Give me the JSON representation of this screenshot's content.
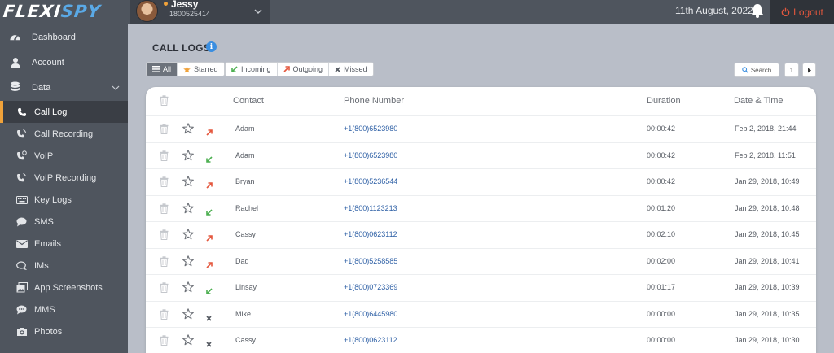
{
  "header": {
    "logo_part1": "FLEXI",
    "logo_part2": "SPY",
    "user": {
      "name": "Jessy",
      "phone": "1800525414"
    },
    "date": "11th August, 2022",
    "logout_label": "Logout"
  },
  "sidebar": {
    "items": [
      {
        "label": "Dashboard",
        "icon": "dashboard-icon"
      },
      {
        "label": "Account",
        "icon": "user-icon"
      },
      {
        "label": "Data",
        "icon": "database-icon"
      },
      {
        "label": "Call Log",
        "icon": "phone-icon",
        "active": true
      },
      {
        "label": "Call Recording",
        "icon": "call-recording-icon"
      },
      {
        "label": "VoIP",
        "icon": "voip-icon"
      },
      {
        "label": "VoIP Recording",
        "icon": "voip-recording-icon"
      },
      {
        "label": "Key Logs",
        "icon": "keyboard-icon"
      },
      {
        "label": "SMS",
        "icon": "chat-bubble-icon"
      },
      {
        "label": "Emails",
        "icon": "envelope-icon"
      },
      {
        "label": "IMs",
        "icon": "im-icon"
      },
      {
        "label": "App Screenshots",
        "icon": "screenshot-icon"
      },
      {
        "label": "MMS",
        "icon": "mms-icon"
      },
      {
        "label": "Photos",
        "icon": "camera-icon"
      }
    ]
  },
  "main": {
    "title": "CALL LOGS",
    "filters": {
      "all": "All",
      "starred": "Starred",
      "incoming": "Incoming",
      "outgoing": "Outgoing",
      "missed": "Missed"
    },
    "search_label": "Search",
    "page_number": "1",
    "columns": {
      "contact": "Contact",
      "phone": "Phone Number",
      "duration": "Duration",
      "datetime": "Date & Time"
    },
    "rows": [
      {
        "direction": "outgoing",
        "contact": "Adam",
        "phone": "+1(800)6523980",
        "duration": "00:00:42",
        "datetime": "Feb 2, 2018, 21:44"
      },
      {
        "direction": "incoming",
        "contact": "Adam",
        "phone": "+1(800)6523980",
        "duration": "00:00:42",
        "datetime": "Feb 2, 2018, 11:51"
      },
      {
        "direction": "outgoing",
        "contact": "Bryan",
        "phone": "+1(800)5236544",
        "duration": "00:00:42",
        "datetime": "Jan 29, 2018, 10:49"
      },
      {
        "direction": "incoming",
        "contact": "Rachel",
        "phone": "+1(800)1123213",
        "duration": "00:01:20",
        "datetime": "Jan 29, 2018, 10:48"
      },
      {
        "direction": "outgoing",
        "contact": "Cassy",
        "phone": "+1(800)0623112",
        "duration": "00:02:10",
        "datetime": "Jan 29, 2018, 10:45"
      },
      {
        "direction": "outgoing",
        "contact": "Dad",
        "phone": "+1(800)5258585",
        "duration": "00:02:00",
        "datetime": "Jan 29, 2018, 10:41"
      },
      {
        "direction": "incoming",
        "contact": "Linsay",
        "phone": "+1(800)0723369",
        "duration": "00:01:17",
        "datetime": "Jan 29, 2018, 10:39"
      },
      {
        "direction": "missed",
        "contact": "Mike",
        "phone": "+1(800)6445980",
        "duration": "00:00:00",
        "datetime": "Jan 29, 2018, 10:35"
      },
      {
        "direction": "missed",
        "contact": "Cassy",
        "phone": "+1(800)0623112",
        "duration": "00:00:00",
        "datetime": "Jan 29, 2018, 10:30"
      }
    ]
  },
  "colors": {
    "accent": "#f0a23a",
    "outgoing": "#e4573d",
    "incoming": "#4caf50",
    "missed": "#555a62",
    "link": "#2d5fa5",
    "logout": "#e4573d"
  }
}
